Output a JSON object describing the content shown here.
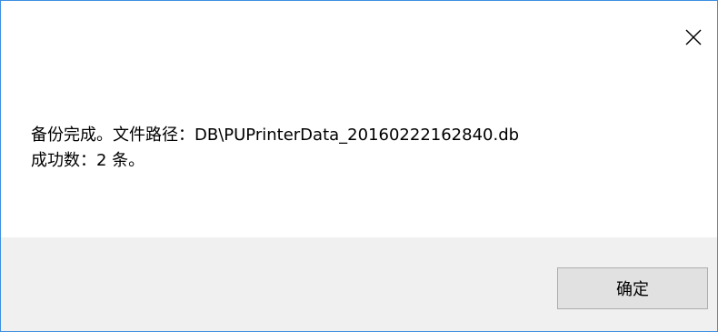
{
  "dialog": {
    "close_icon": "close-icon",
    "message_line_1": "备份完成。文件路径：DB\\PUPrinterData_20160222162840.db",
    "message_line_2": "成功数：2 条。"
  },
  "footer": {
    "ok_label": "确定"
  },
  "colors": {
    "window_border": "#3c8ee0",
    "footer_background": "#f0f0f0",
    "button_background": "#e1e1e1",
    "button_border": "#adadad"
  }
}
